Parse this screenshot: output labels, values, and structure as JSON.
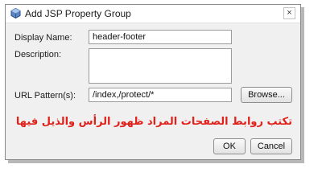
{
  "window": {
    "title": "Add JSP Property Group",
    "close_symbol": "×",
    "icon": "netbeans-cube-icon"
  },
  "form": {
    "display_name_label": "Display Name:",
    "display_name_value": "header-footer",
    "description_label": "Description:",
    "description_value": "",
    "url_pattern_label": "URL Pattern(s):",
    "url_pattern_value": "/index,/protect/*",
    "browse_label": "Browse..."
  },
  "annotation": {
    "text": "تكتب روابط الصفحات المراد ظهور الرأس والذيل فيها",
    "color": "#e0201a"
  },
  "footer": {
    "ok_label": "OK",
    "cancel_label": "Cancel"
  }
}
